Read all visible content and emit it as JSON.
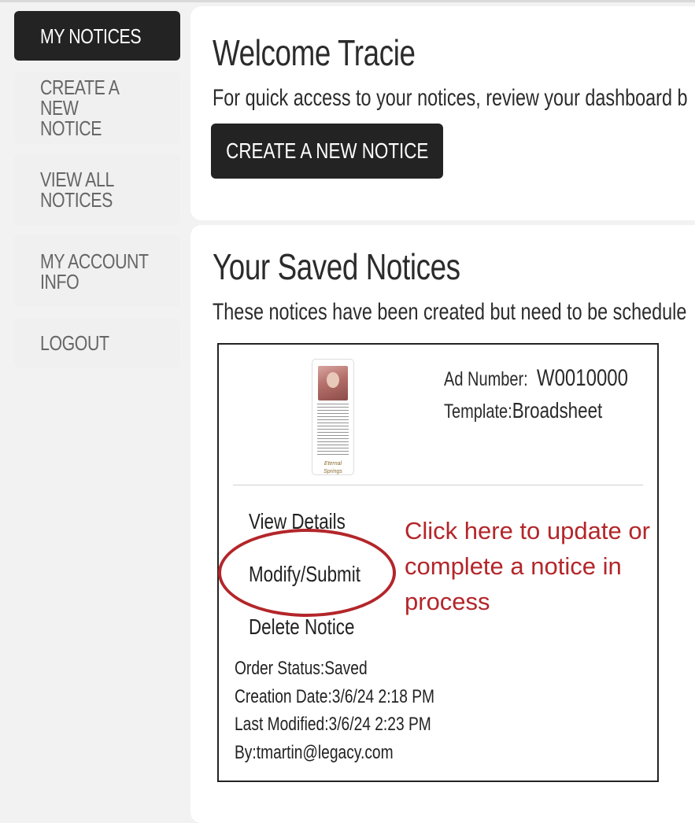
{
  "sidebar": {
    "items": [
      {
        "label": "MY NOTICES",
        "active": true
      },
      {
        "label": "CREATE A NEW\nNOTICE",
        "active": false
      },
      {
        "label": "VIEW ALL\nNOTICES",
        "active": false
      },
      {
        "label": "MY ACCOUNT\nINFO",
        "active": false
      },
      {
        "label": "LOGOUT",
        "active": false
      }
    ]
  },
  "welcome": {
    "title": "Welcome Tracie",
    "subtitle": "For quick access to your notices, review your dashboard b",
    "create_button": "CREATE A NEW NOTICE"
  },
  "saved": {
    "title": "Your Saved Notices",
    "subtitle": "These notices have been created but need to be schedule"
  },
  "notice_card": {
    "ad_number_label": "Ad Number:",
    "ad_number": "W0010000",
    "template_label": "Template:",
    "template": "Broadsheet",
    "thumbnail_signature": "Eternal Springs",
    "actions": {
      "view": "View Details",
      "modify": "Modify/Submit",
      "delete": "Delete Notice"
    },
    "order_status_label": "Order Status:",
    "order_status": "Saved",
    "creation_date_label": "Creation Date:",
    "creation_date": "3/6/24 2:18 PM",
    "last_modified_label": "Last Modified:",
    "last_modified": "3/6/24 2:23 PM",
    "by_label": "By:",
    "by": "tmartin@legacy.com"
  },
  "annotation": {
    "text": "Click here to update or complete a notice in process",
    "color": "#b3262a"
  },
  "colors": {
    "dark": "#232323",
    "nav_bg": "#f0f0f0",
    "accent_red": "#b3262a"
  }
}
